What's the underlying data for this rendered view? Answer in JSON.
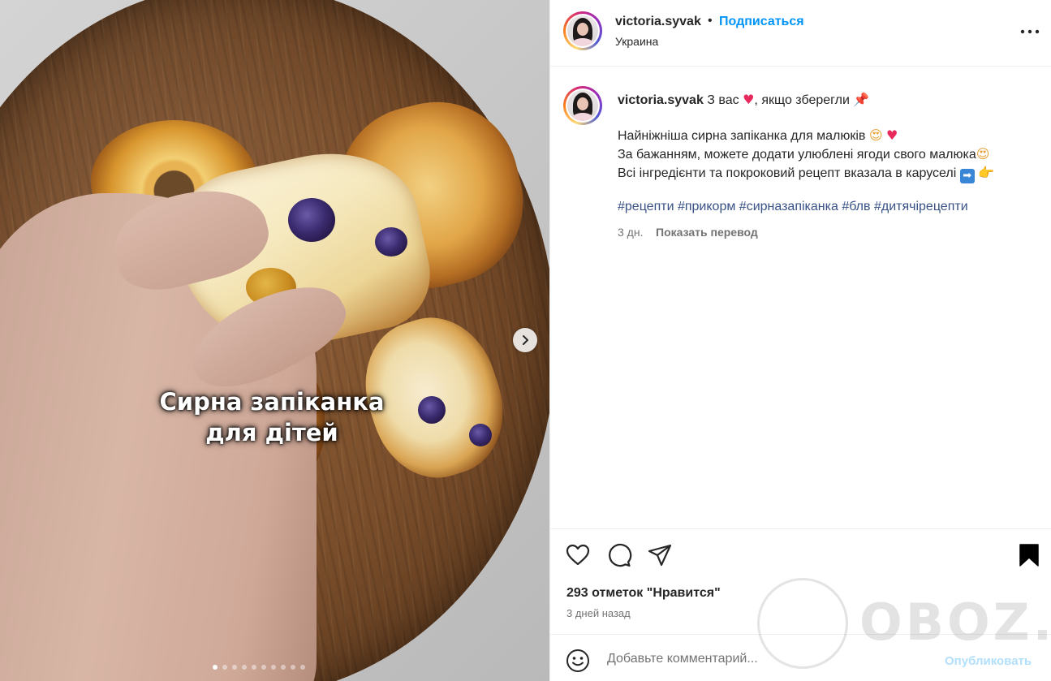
{
  "post": {
    "username": "victoria.syvak",
    "separator": "•",
    "follow_label": "Подписаться",
    "location": "Украина",
    "more_icon": "more-horizontal-icon"
  },
  "media": {
    "overlay_line1": "Сирна запіканка",
    "overlay_line2": "для дітей",
    "slide_count": 10,
    "active_slide": 1,
    "next_icon": "chevron-right-icon"
  },
  "caption": {
    "username": "victoria.syvak",
    "first_text_a": " З вас ",
    "first_emoji_a": "♥",
    "first_text_b": ", якщо зберегли ",
    "first_emoji_b": "📌",
    "line1_text": "Найніжніша сирна запіканка для малюків ",
    "line1_emoji_a": "😍",
    "line1_emoji_b": "♥",
    "line2_text": "За бажанням, можете додати улюблені ягоди свого малюка",
    "line2_emoji": "😍",
    "line3_text": "Всі інгредієнти та покроковий рецепт вказала в каруселі ",
    "line3_emoji_a": "➡",
    "line3_emoji_b": "👉",
    "hashtags": [
      "#рецепти",
      "#прикорм",
      "#сирназапіканка",
      "#блв",
      "#дитячірецепти"
    ],
    "time": "3 дн.",
    "translate_label": "Показать перевод"
  },
  "actions": {
    "like_icon": "heart-icon",
    "comment_icon": "comment-icon",
    "share_icon": "send-icon",
    "save_icon": "bookmark-icon",
    "likes_text": "293 отметок \"Нравится\"",
    "time_text": "3 дней назад"
  },
  "comment": {
    "emoji_icon": "smiley-icon",
    "placeholder": "Добавьте комментарий...",
    "publish_label": "Опубликовать"
  },
  "watermark": {
    "text": "OBOZ.UA"
  },
  "colors": {
    "link_blue": "#0095f6",
    "hashtag": "#385185",
    "muted": "#737373",
    "publish_disabled": "#b2dffc"
  }
}
